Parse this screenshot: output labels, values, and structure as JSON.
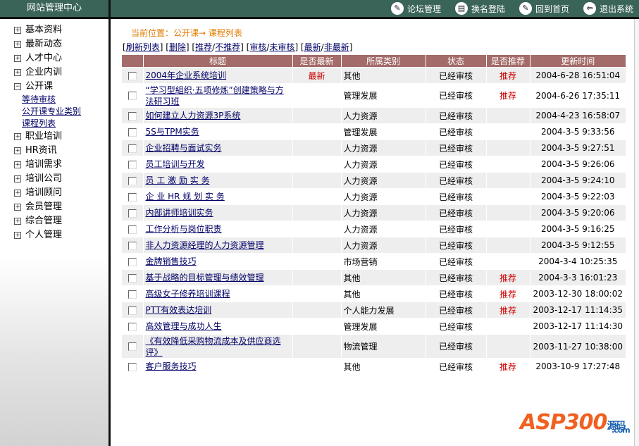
{
  "header": {
    "brand": "网站管理中心",
    "nav": [
      {
        "label": "论坛管理",
        "icon": "wrench-icon"
      },
      {
        "label": "换名登陆",
        "icon": "document-icon"
      },
      {
        "label": "回到首页",
        "icon": "wrench-icon"
      },
      {
        "label": "退出系统",
        "icon": "exit-icon"
      }
    ]
  },
  "sidebar": {
    "items": [
      {
        "label": "基本资料",
        "expanded": false
      },
      {
        "label": "最新动态",
        "expanded": false
      },
      {
        "label": "人才中心",
        "expanded": false
      },
      {
        "label": "企业内训",
        "expanded": false
      },
      {
        "label": "公开课",
        "expanded": true,
        "children": [
          "等待审核",
          "公开课专业类别",
          "课程列表"
        ]
      },
      {
        "label": "职业培训",
        "expanded": false
      },
      {
        "label": "HR资讯",
        "expanded": false
      },
      {
        "label": "培训需求",
        "expanded": false
      },
      {
        "label": "培训公司",
        "expanded": false
      },
      {
        "label": "培训顾问",
        "expanded": false
      },
      {
        "label": "会员管理",
        "expanded": false
      },
      {
        "label": "综合管理",
        "expanded": false
      },
      {
        "label": "个人管理",
        "expanded": false
      }
    ]
  },
  "main": {
    "breadcrumb": "当前位置：公开课→ 课程列表",
    "actions": {
      "refresh": "刷新列表",
      "delete": "删除",
      "recommend": "推荐",
      "unrecommend": "不推荐",
      "approve": "审核",
      "unapprove": "未审核",
      "newest": "最新",
      "notnewest": "非最新"
    },
    "columns": [
      "标题",
      "是否最新",
      "所属类别",
      "状态",
      "是否推荐",
      "更新时间"
    ],
    "rows": [
      [
        "2004年企业系统培训",
        "最新",
        "其他",
        "已经审核",
        "推荐",
        "2004-6-28 16:51:04"
      ],
      [
        "“学习型組织·五项修炼”创建策略与方法研习班",
        "",
        "管理发展",
        "已经审核",
        "推荐",
        "2004-6-26 17:35:11"
      ],
      [
        "如何建立人力资源3P系统",
        "",
        "人力资源",
        "已经审核",
        "",
        "2004-4-23 16:58:07"
      ],
      [
        "5S与TPM实务",
        "",
        "管理发展",
        "已经审核",
        "",
        "2004-3-5 9:33:56"
      ],
      [
        "企业招聘与面试实务",
        "",
        "人力资源",
        "已经审核",
        "",
        "2004-3-5 9:27:51"
      ],
      [
        "员工培训与开发",
        "",
        "人力资源",
        "已经审核",
        "",
        "2004-3-5 9:26:06"
      ],
      [
        "员 工 激 励 实 务",
        "",
        "人力资源",
        "已经审核",
        "",
        "2004-3-5 9:24:10"
      ],
      [
        "企 业 HR 规 划 实 务",
        "",
        "人力资源",
        "已经审核",
        "",
        "2004-3-5 9:22:03"
      ],
      [
        "内部讲师培训实务",
        "",
        "人力资源",
        "已经审核",
        "",
        "2004-3-5 9:20:06"
      ],
      [
        "工作分析与岗位职责",
        "",
        "人力资源",
        "已经审核",
        "",
        "2004-3-5 9:16:25"
      ],
      [
        "非人力资源经理的人力资源管理",
        "",
        "人力资源",
        "已经审核",
        "",
        "2004-3-5 9:12:55"
      ],
      [
        "金牌销售技巧",
        "",
        "市场营销",
        "已经审核",
        "",
        "2004-3-4 10:25:35"
      ],
      [
        "基于战略的目标管理与绩效管理",
        "",
        "其他",
        "已经审核",
        "推荐",
        "2004-3-3 16:01:23"
      ],
      [
        "高级女子修养培训课程",
        "",
        "其他",
        "已经审核",
        "推荐",
        "2003-12-30 18:00:02"
      ],
      [
        "PTT有效表达培训",
        "",
        "个人能力发展",
        "已经审核",
        "推荐",
        "2003-12-17 11:14:35"
      ],
      [
        "高效管理与成功人生",
        "",
        "管理发展",
        "已经审核",
        "",
        "2003-12-17 11:14:30"
      ],
      [
        "《有效降低采购物流成本及供应商选评》",
        "",
        "物流管理",
        "已经审核",
        "",
        "2003-11-27 10:38:00"
      ],
      [
        "客户服务技巧",
        "",
        "其他",
        "已经审核",
        "推荐",
        "2003-10-9 17:27:48"
      ]
    ]
  },
  "logo": {
    "text": "ASP300",
    "sub": "源码",
    ".com": ".com"
  },
  "colors": {
    "header": "#3b6459",
    "table_header": "#a36b69",
    "accent_red": "#cc0000",
    "breadcrumb": "#e07b00"
  }
}
